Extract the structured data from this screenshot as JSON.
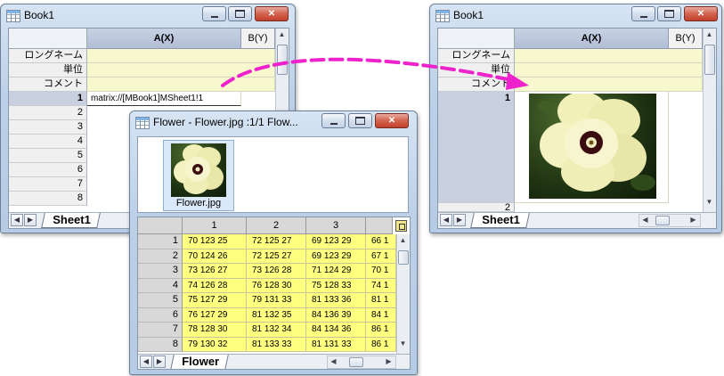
{
  "book_left": {
    "title": "Book1",
    "columns": [
      "A(X)",
      "B(Y)"
    ],
    "meta_rows": [
      "ロングネーム",
      "単位",
      "コメント"
    ],
    "row_numbers": [
      "1",
      "2",
      "3",
      "4",
      "5",
      "6",
      "7",
      "8"
    ],
    "cell_a1": "matrix://[MBook1]MSheet1!1",
    "sheet_tab": "Sheet1"
  },
  "book_right": {
    "title": "Book1",
    "columns": [
      "A(X)",
      "B(Y)"
    ],
    "meta_rows": [
      "ロングネーム",
      "単位",
      "コメント"
    ],
    "row_numbers": [
      "1",
      "2"
    ],
    "sheet_tab": "Sheet1",
    "image_name": "flower-thumbnail"
  },
  "flower_window": {
    "title": "Flower - Flower.jpg :1/1 Flow...",
    "thumbnail_label": "Flower.jpg",
    "columns": [
      "1",
      "2",
      "3",
      ""
    ],
    "rows": [
      {
        "n": "1",
        "cells": [
          "70 123 25",
          "72 125 27",
          "69 123 29",
          "66 1"
        ]
      },
      {
        "n": "2",
        "cells": [
          "70 124 26",
          "72 125 27",
          "69 123 29",
          "67 1"
        ]
      },
      {
        "n": "3",
        "cells": [
          "73 126 27",
          "73 126 28",
          "71 124 29",
          "70 1"
        ]
      },
      {
        "n": "4",
        "cells": [
          "74 126 28",
          "76 128 30",
          "75 128 33",
          "74 1"
        ]
      },
      {
        "n": "5",
        "cells": [
          "75 127 29",
          "79 131 33",
          "81 133 36",
          "81 1"
        ]
      },
      {
        "n": "6",
        "cells": [
          "76 127 29",
          "81 132 35",
          "84 136 39",
          "84 1"
        ]
      },
      {
        "n": "7",
        "cells": [
          "78 128 30",
          "81 132 34",
          "84 134 36",
          "86 1"
        ]
      },
      {
        "n": "8",
        "cells": [
          "79 130 32",
          "81 133 33",
          "81 131 33",
          "86 1"
        ]
      }
    ],
    "sheet_tab": "Flower"
  },
  "icons": {
    "book": "worksheet-grid-icon",
    "matrix": "matrix-grid-icon",
    "minimize": "minimize-icon",
    "maximize": "maximize-icon",
    "close": "close-icon"
  },
  "colors": {
    "arrow": "#ee22cc",
    "meta_row_bg": "#f8f8cf",
    "matrix_cell_bg": "#ffff80",
    "close_button": "#d2634f"
  }
}
